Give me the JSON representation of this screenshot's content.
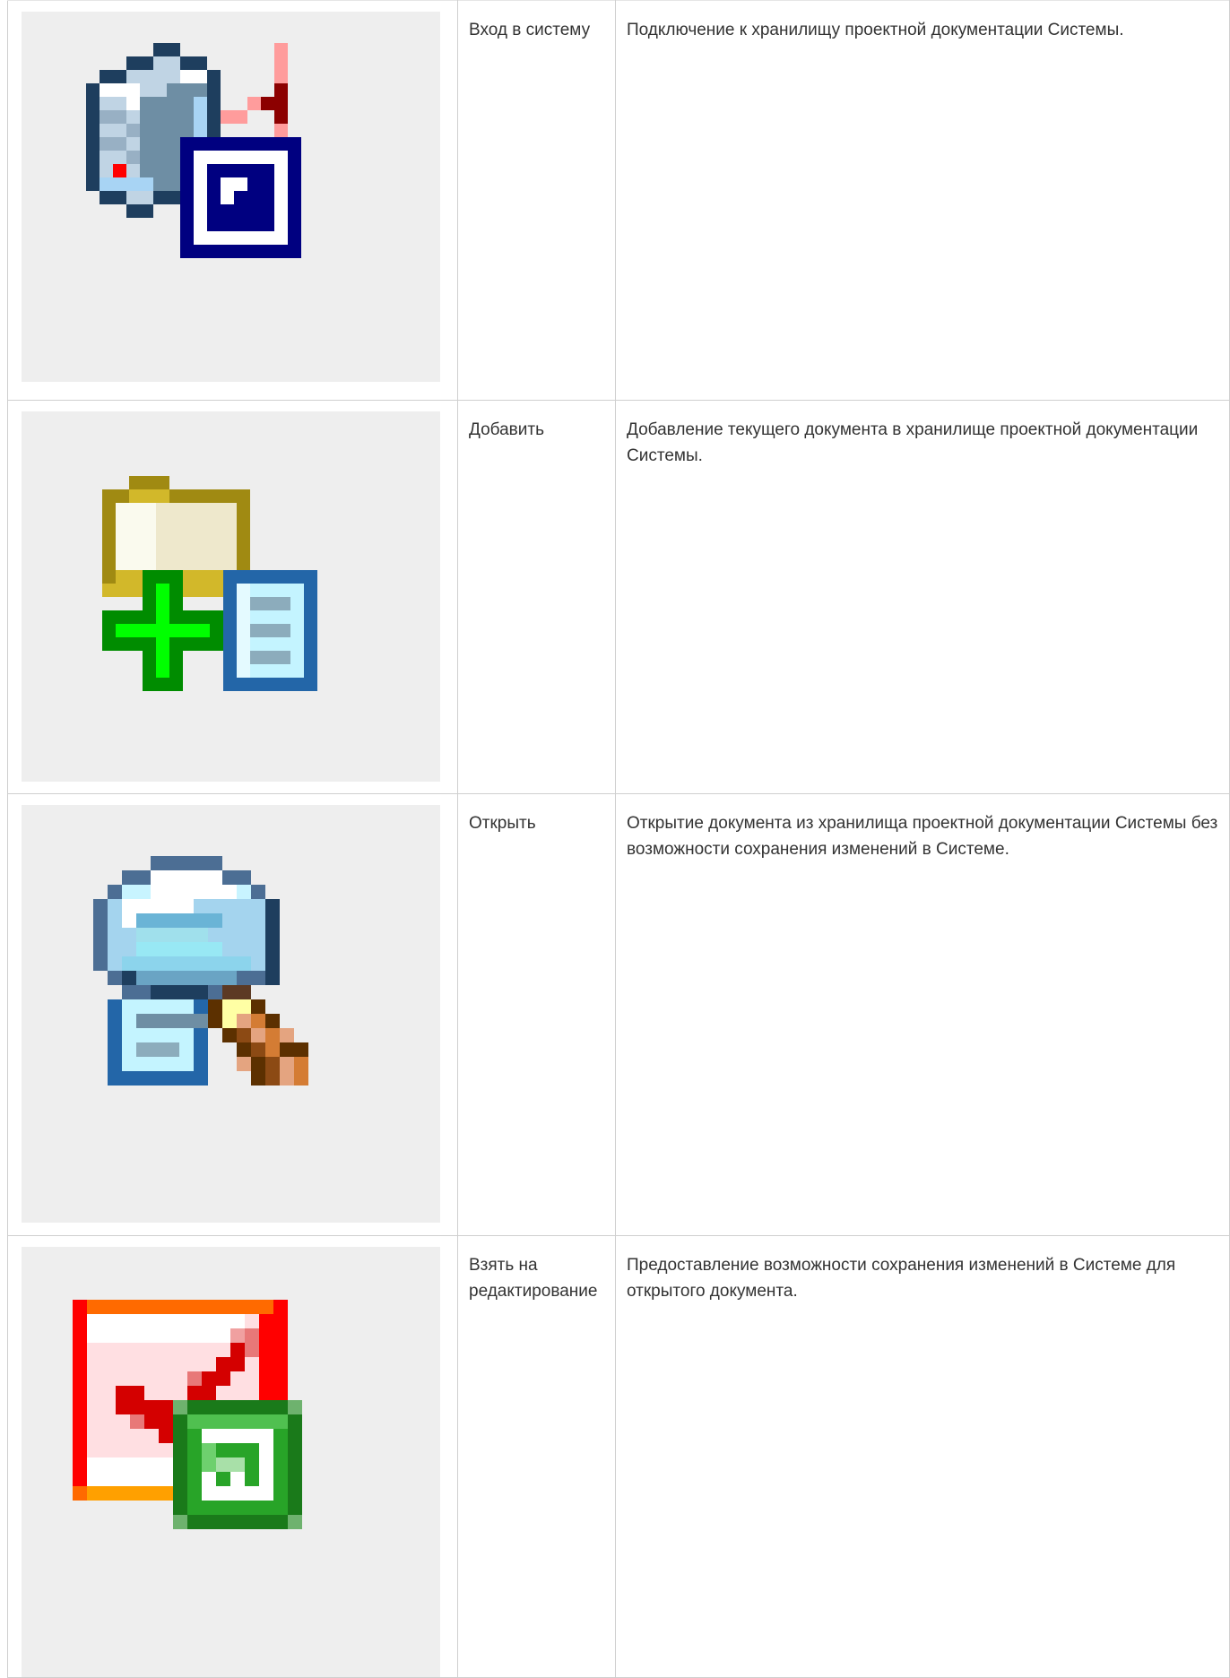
{
  "rows": [
    {
      "icon": "login-icon",
      "name": "Вход в систему",
      "description": "Подключение к хранилищу проектной документации Системы."
    },
    {
      "icon": "add-document-icon",
      "name": "Добавить",
      "description": "Добавление текущего документа в хранилище проектной документации Системы."
    },
    {
      "icon": "open-document-icon",
      "name": "Открыть",
      "description": "Открытие документа из хранилища проектной документации Системы без возможности сохранения изменений в Системе."
    },
    {
      "icon": "checkout-edit-icon",
      "name": "Взять на редактирование",
      "description": "Предоставление возможности сохранения изменений в Системе для открытого документа."
    }
  ]
}
